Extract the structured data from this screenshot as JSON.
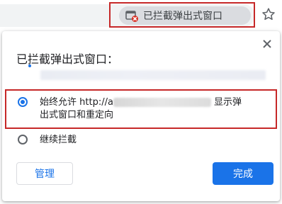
{
  "toolbar": {
    "blocked_chip_label": "已拦截弹出式窗口",
    "chip_icon": "popup-blocked-icon",
    "star_icon": "star-icon"
  },
  "bubble": {
    "title": "已拦截弹出式窗口：",
    "close_icon": "close-icon",
    "options": {
      "allow_prefix": "始终允许 http://a",
      "allow_suffix_line1": "显示弹",
      "allow_line2": "出式窗口和重定向",
      "block_label": "继续拦截",
      "selected": "allow"
    },
    "buttons": {
      "manage_label": "管理",
      "done_label": "完成"
    }
  },
  "colors": {
    "accent": "#1a73e8",
    "highlight": "#c62828",
    "chip_bg": "#dadce0"
  }
}
